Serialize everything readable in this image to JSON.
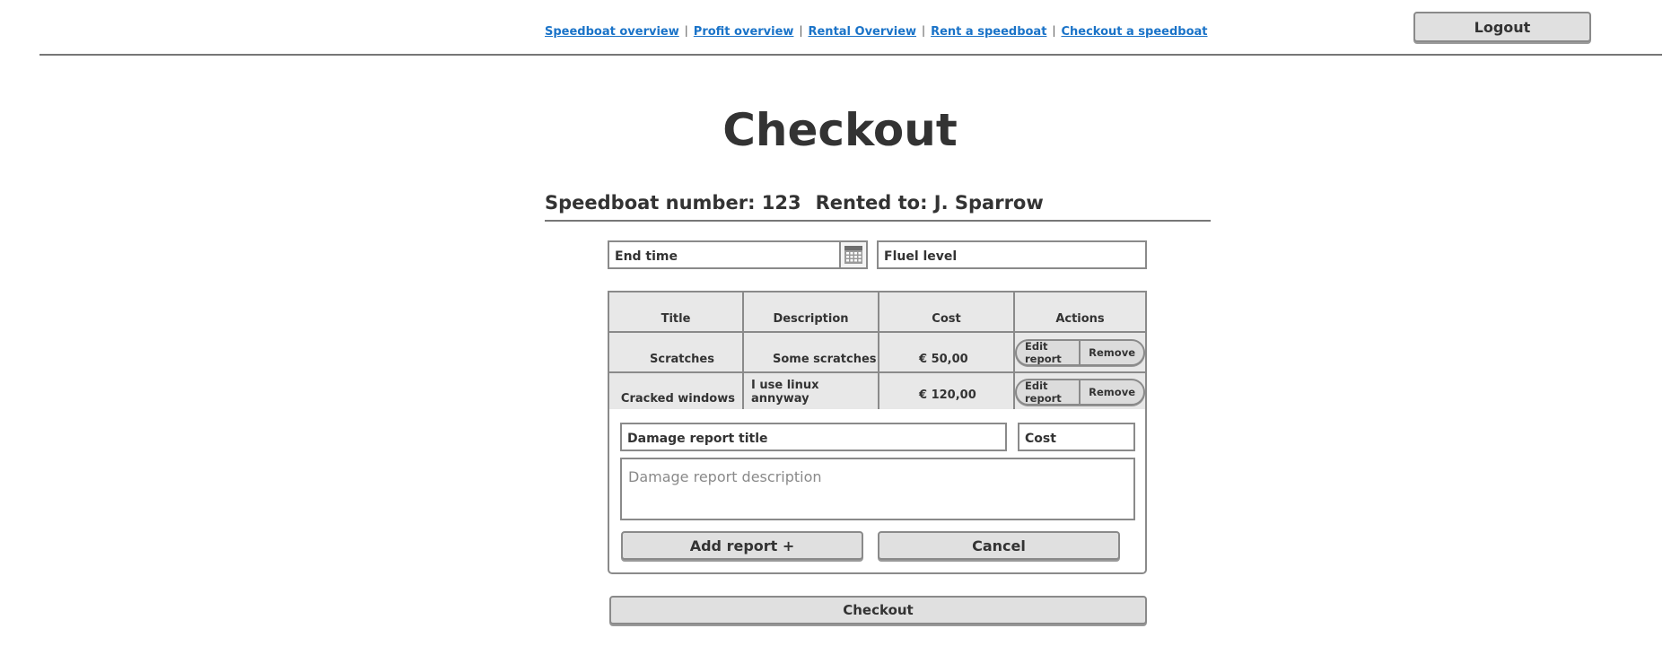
{
  "nav": {
    "links": [
      "Speedboat overview",
      "Profit overview",
      "Rental Overview",
      "Rent a speedboat",
      "Checkout a speedboat"
    ],
    "separator": "|",
    "logout_label": "Logout"
  },
  "page": {
    "title": "Checkout",
    "speedboat_label": "Speedboat number: 123",
    "rented_label": "Rented to: J. Sparrow"
  },
  "form": {
    "end_time": "End time",
    "fuel_level": "Fluel level"
  },
  "table": {
    "headers": [
      "Title",
      "Description",
      "Cost",
      "Actions"
    ],
    "rows": [
      {
        "title": "Scratches",
        "description": "Some scratches",
        "cost": "€ 50,00",
        "edit": "Edit report",
        "remove": "Remove"
      },
      {
        "title": "Cracked windows",
        "description": "I use linux annyway",
        "cost": "€ 120,00",
        "edit": "Edit report",
        "remove": "Remove"
      }
    ]
  },
  "damage_form": {
    "title_value": "Damage report title",
    "cost_value": "Cost",
    "description_placeholder": "Damage report description",
    "add_label": "Add report +",
    "cancel_label": "Cancel"
  },
  "checkout_label": "Checkout"
}
